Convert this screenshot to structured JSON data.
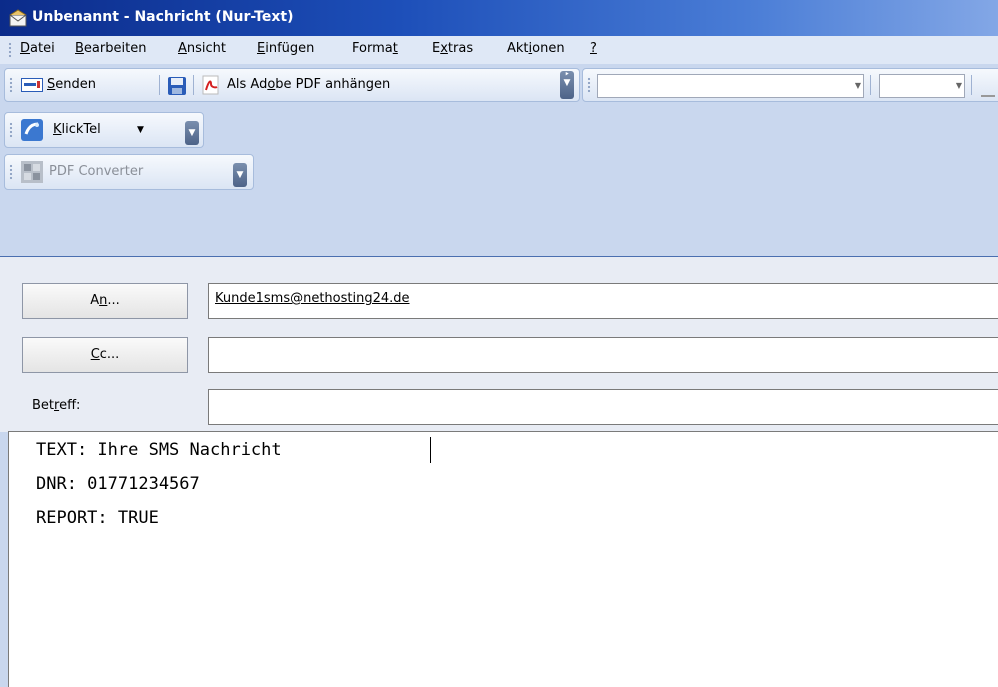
{
  "window": {
    "title": "Unbenannt - Nachricht (Nur-Text)"
  },
  "menu": [
    {
      "label": "Datei",
      "key": "D",
      "rest": "atei"
    },
    {
      "label": "Bearbeiten",
      "key": "B",
      "rest": "earbeiten"
    },
    {
      "label": "Ansicht",
      "key": "A",
      "rest": "nsicht"
    },
    {
      "label": "Einfügen",
      "key": "E",
      "rest": "infügen"
    },
    {
      "label": "Format",
      "pre": "Forma",
      "key": "t"
    },
    {
      "label": "Extras",
      "pre": "E",
      "key": "x",
      "rest": "tras"
    },
    {
      "label": "Aktionen",
      "pre": "Akt",
      "key": "i",
      "rest": "onen"
    },
    {
      "label": "?",
      "key": "?"
    }
  ],
  "toolbar": {
    "send_key": "S",
    "send_rest": "enden",
    "pdf_pre": "Als Ad",
    "pdf_key": "o",
    "pdf_rest": "be PDF anhängen",
    "klicktel_key": "K",
    "klicktel_rest": "lickTel",
    "pdf_converter": "PDF Converter"
  },
  "fields": {
    "to_label_pre": "A",
    "to_label_key": "n",
    "to_label_rest": "...",
    "to_value": "Kunde1sms@nethosting24.de",
    "cc_label_key": "C",
    "cc_label_rest": "c...",
    "cc_value": "",
    "subject_label_pre": "Bet",
    "subject_label_key": "r",
    "subject_label_rest": "eff:",
    "subject_value": ""
  },
  "body": {
    "lines": [
      "TEXT: Ihre SMS Nachricht",
      "DNR: 01771234567",
      "REPORT: TRUE"
    ]
  },
  "colors": {
    "titlebar_start": "#0b2b8a",
    "titlebar_end": "#83a7e6",
    "toolbar_bg": "#c9d7ee",
    "pdf_red": "#d42020"
  }
}
